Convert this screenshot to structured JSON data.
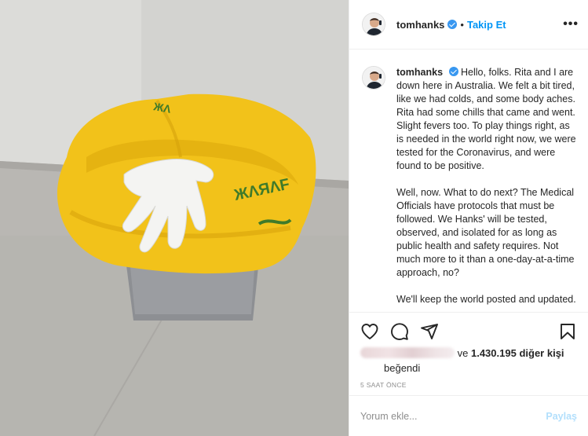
{
  "post": {
    "username": "tomhanks",
    "separator": "•",
    "follow_label": "Takip Et",
    "more_label": "•••"
  },
  "caption": {
    "username": "tomhanks",
    "paragraph1": "Hello, folks. Rita and I are down here in Australia. We felt a bit tired, like we had colds, and some body aches. Rita had some chills that came and went. Slight fevers too. To play things right, as is needed in the world right now, we were tested for the Coronavirus, and were found to be positive.",
    "paragraph2": "Well, now. What to do next? The Medical Officials have protocols that must be followed. We Hanks' will be tested, observed, and isolated for as long as public health and safety requires. Not much more to it than a one-day-at-a-time approach, no?",
    "paragraph3": "We'll keep the world posted and updated."
  },
  "actions": {
    "like_icon": "heart-icon",
    "comment_icon": "comment-icon",
    "share_icon": "share-icon",
    "save_icon": "bookmark-icon"
  },
  "likes": {
    "prefix": "ve",
    "count": "1.430.195",
    "suffix": "diğer kişi",
    "liked_label": "beğendi"
  },
  "timestamp": "5 SAAT ÖNCE",
  "comment": {
    "placeholder": "Yorum ekle...",
    "post_label": "Paylaş"
  },
  "colors": {
    "accent": "#0095f6",
    "verified": "#3897f0",
    "bag_yellow": "#f2c21a",
    "post_disabled": "#b2dffc"
  }
}
